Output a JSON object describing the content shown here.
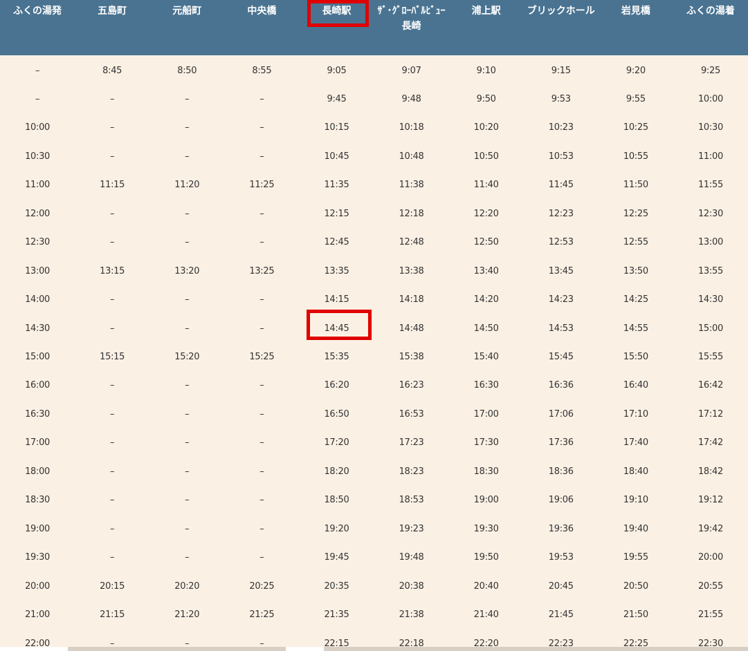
{
  "timetable": {
    "headers": [
      "ふくの湯発",
      "五島町",
      "元船町",
      "中央橋",
      "長崎駅",
      "ｻﾞ･ｸﾞﾛｰﾊﾞﾙﾋﾞｭｰ\n長崎",
      "浦上駅",
      "ブリックホール",
      "岩見橋",
      "ふくの湯着"
    ],
    "rows": [
      [
        "–",
        "8:45",
        "8:50",
        "8:55",
        "9:05",
        "9:07",
        "9:10",
        "9:15",
        "9:20",
        "9:25"
      ],
      [
        "–",
        "–",
        "–",
        "–",
        "9:45",
        "9:48",
        "9:50",
        "9:53",
        "9:55",
        "10:00"
      ],
      [
        "10:00",
        "–",
        "–",
        "–",
        "10:15",
        "10:18",
        "10:20",
        "10:23",
        "10:25",
        "10:30"
      ],
      [
        "10:30",
        "–",
        "–",
        "–",
        "10:45",
        "10:48",
        "10:50",
        "10:53",
        "10:55",
        "11:00"
      ],
      [
        "11:00",
        "11:15",
        "11:20",
        "11:25",
        "11:35",
        "11:38",
        "11:40",
        "11:45",
        "11:50",
        "11:55"
      ],
      [
        "12:00",
        "–",
        "–",
        "–",
        "12:15",
        "12:18",
        "12:20",
        "12:23",
        "12:25",
        "12:30"
      ],
      [
        "12:30",
        "–",
        "–",
        "–",
        "12:45",
        "12:48",
        "12:50",
        "12:53",
        "12:55",
        "13:00"
      ],
      [
        "13:00",
        "13:15",
        "13:20",
        "13:25",
        "13:35",
        "13:38",
        "13:40",
        "13:45",
        "13:50",
        "13:55"
      ],
      [
        "14:00",
        "–",
        "–",
        "–",
        "14:15",
        "14:18",
        "14:20",
        "14:23",
        "14:25",
        "14:30"
      ],
      [
        "14:30",
        "–",
        "–",
        "–",
        "14:45",
        "14:48",
        "14:50",
        "14:53",
        "14:55",
        "15:00"
      ],
      [
        "15:00",
        "15:15",
        "15:20",
        "15:25",
        "15:35",
        "15:38",
        "15:40",
        "15:45",
        "15:50",
        "15:55"
      ],
      [
        "16:00",
        "–",
        "–",
        "–",
        "16:20",
        "16:23",
        "16:30",
        "16:36",
        "16:40",
        "16:42"
      ],
      [
        "16:30",
        "–",
        "–",
        "–",
        "16:50",
        "16:53",
        "17:00",
        "17:06",
        "17:10",
        "17:12"
      ],
      [
        "17:00",
        "–",
        "–",
        "–",
        "17:20",
        "17:23",
        "17:30",
        "17:36",
        "17:40",
        "17:42"
      ],
      [
        "18:00",
        "–",
        "–",
        "–",
        "18:20",
        "18:23",
        "18:30",
        "18:36",
        "18:40",
        "18:42"
      ],
      [
        "18:30",
        "–",
        "–",
        "–",
        "18:50",
        "18:53",
        "19:00",
        "19:06",
        "19:10",
        "19:12"
      ],
      [
        "19:00",
        "–",
        "–",
        "–",
        "19:20",
        "19:23",
        "19:30",
        "19:36",
        "19:40",
        "19:42"
      ],
      [
        "19:30",
        "–",
        "–",
        "–",
        "19:45",
        "19:48",
        "19:50",
        "19:53",
        "19:55",
        "20:00"
      ],
      [
        "20:00",
        "20:15",
        "20:20",
        "20:25",
        "20:35",
        "20:38",
        "20:40",
        "20:45",
        "20:50",
        "20:55"
      ],
      [
        "21:00",
        "21:15",
        "21:20",
        "21:25",
        "21:35",
        "21:38",
        "21:40",
        "21:45",
        "21:50",
        "21:55"
      ],
      [
        "22:00",
        "–",
        "–",
        "–",
        "22:15",
        "22:18",
        "22:20",
        "22:23",
        "22:25",
        "22:30"
      ]
    ],
    "highlights": [
      {
        "row": "header",
        "col": 4
      },
      {
        "row": 9,
        "col": 4
      }
    ]
  },
  "colors": {
    "header_bg": "#4a7391",
    "header_text": "#ffffff",
    "body_bg": "#faf0e4",
    "cell_text": "#333333",
    "highlight": "#e00000"
  }
}
